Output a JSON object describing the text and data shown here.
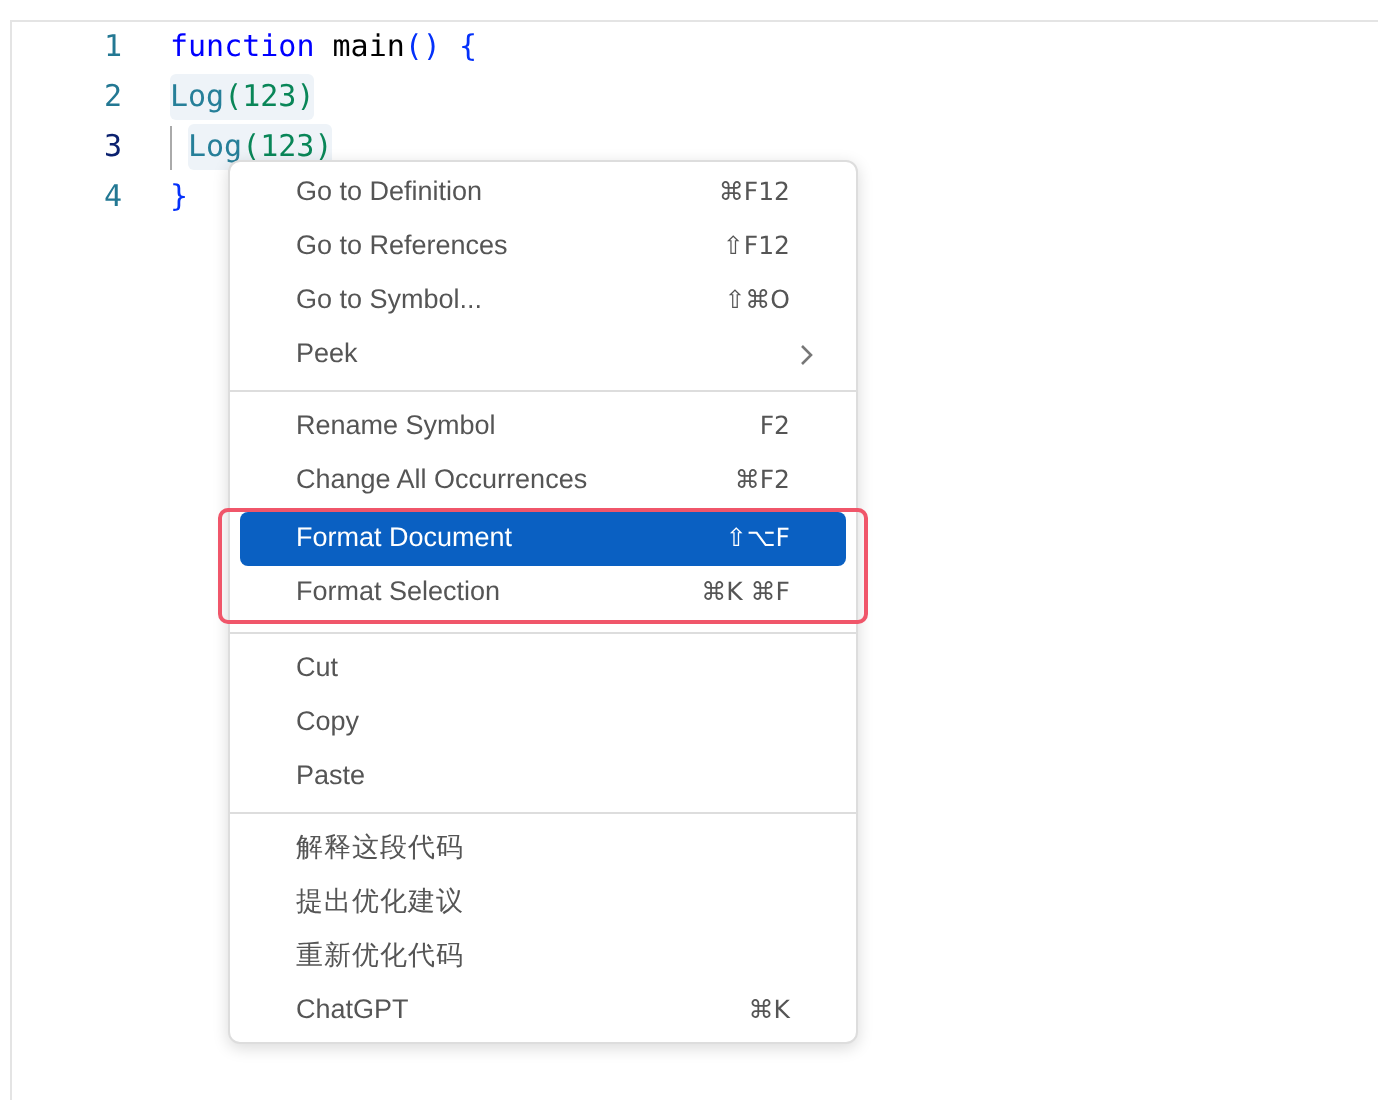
{
  "editor": {
    "lines": [
      {
        "number": "1",
        "current": false,
        "tokens": [
          {
            "kind": "keyword",
            "text": "function"
          },
          {
            "kind": "plain",
            "text": " main"
          },
          {
            "kind": "bracket",
            "text": "() {"
          }
        ]
      },
      {
        "number": "2",
        "current": false,
        "tokens": [
          {
            "kind": "call",
            "text": "Log"
          },
          {
            "kind": "arg",
            "text": "(123)"
          }
        ]
      },
      {
        "number": "3",
        "current": true,
        "tokens": [
          {
            "kind": "call",
            "text": "Log"
          },
          {
            "kind": "arg",
            "text": "(123)"
          }
        ]
      },
      {
        "number": "4",
        "current": false,
        "tokens": [
          {
            "kind": "bracket",
            "text": "}"
          }
        ]
      }
    ]
  },
  "context_menu": {
    "groups": [
      {
        "items": [
          {
            "label": "Go to Definition",
            "shortcut": "⌘F12",
            "selected": false,
            "has_submenu": false
          },
          {
            "label": "Go to References",
            "shortcut": "⇧F12",
            "selected": false,
            "has_submenu": false
          },
          {
            "label": "Go to Symbol...",
            "shortcut": "⇧⌘O",
            "selected": false,
            "has_submenu": false
          },
          {
            "label": "Peek",
            "selected": false,
            "has_submenu": true
          }
        ]
      },
      {
        "items": [
          {
            "label": "Rename Symbol",
            "shortcut": "F2",
            "selected": false,
            "has_submenu": false
          },
          {
            "label": "Change All Occurrences",
            "shortcut": "⌘F2",
            "selected": false,
            "has_submenu": false
          }
        ],
        "framed_items": [
          {
            "label": "Format Document",
            "shortcut": "⇧⌥F",
            "selected": true,
            "has_submenu": false
          },
          {
            "label": "Format Selection",
            "shortcut": "⌘K ⌘F",
            "selected": false,
            "has_submenu": false
          }
        ]
      },
      {
        "items": [
          {
            "label": "Cut",
            "selected": false,
            "has_submenu": false
          },
          {
            "label": "Copy",
            "selected": false,
            "has_submenu": false
          },
          {
            "label": "Paste",
            "selected": false,
            "has_submenu": false
          }
        ]
      },
      {
        "items": [
          {
            "label": "解释这段代码",
            "selected": false,
            "has_submenu": false
          },
          {
            "label": "提出优化建议",
            "selected": false,
            "has_submenu": false
          },
          {
            "label": "重新优化代码",
            "selected": false,
            "has_submenu": false
          },
          {
            "label": "ChatGPT",
            "shortcut": "⌘K",
            "selected": false,
            "has_submenu": false
          }
        ]
      }
    ]
  }
}
